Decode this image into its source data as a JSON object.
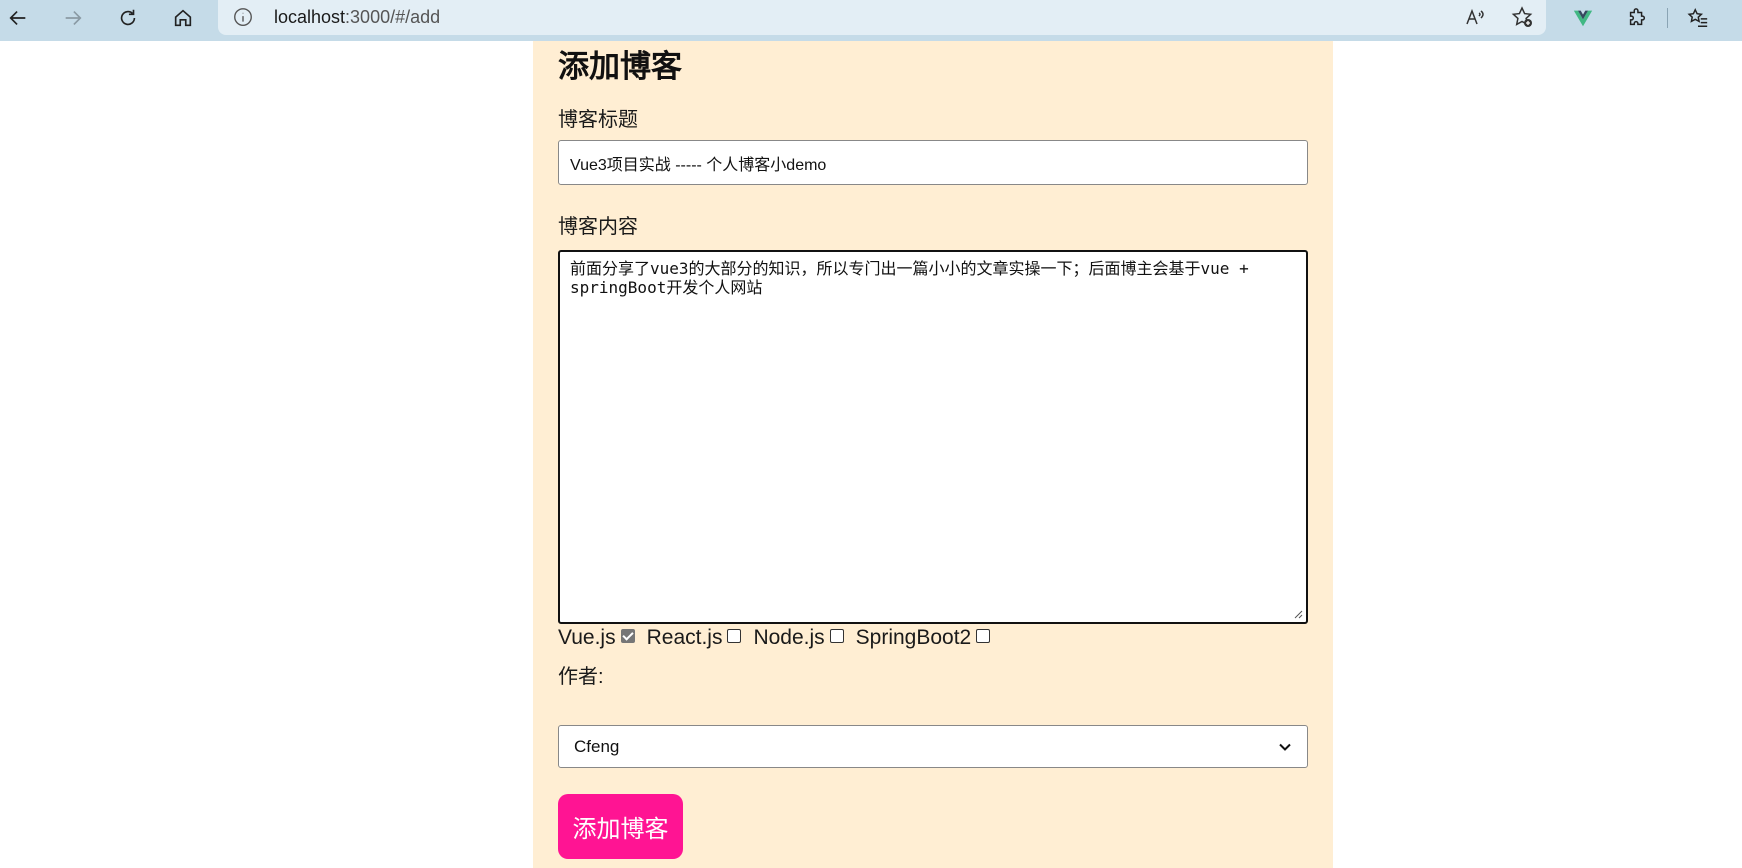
{
  "browser": {
    "url_host": "localhost",
    "url_rest": ":3000/#/add"
  },
  "form": {
    "heading": "添加博客",
    "title_label": "博客标题",
    "title_value": "Vue3项目实战 ----- 个人博客小demo",
    "content_label": "博客内容",
    "content_value": "前面分享了vue3的大部分的知识，所以专门出一篇小小的文章实操一下；后面博主会基于vue + springBoot开发个人网站",
    "categories": [
      {
        "label": "Vue.js",
        "checked": true
      },
      {
        "label": "React.js",
        "checked": false
      },
      {
        "label": "Node.js",
        "checked": false
      },
      {
        "label": "SpringBoot2",
        "checked": false
      }
    ],
    "author_label": "作者:",
    "author_selected": "Cfeng",
    "submit_label": "添加博客"
  },
  "colors": {
    "panel_bg": "#ffeed3",
    "submit_bg": "#ff1493",
    "browser_bar": "#c5dbe8"
  },
  "icons": [
    "back-arrow-icon",
    "forward-arrow-icon",
    "refresh-icon",
    "home-icon",
    "info-icon",
    "read-aloud-icon",
    "add-favorite-icon",
    "vue-devtools-icon",
    "extensions-icon",
    "favorites-icon",
    "chevron-down-icon"
  ]
}
